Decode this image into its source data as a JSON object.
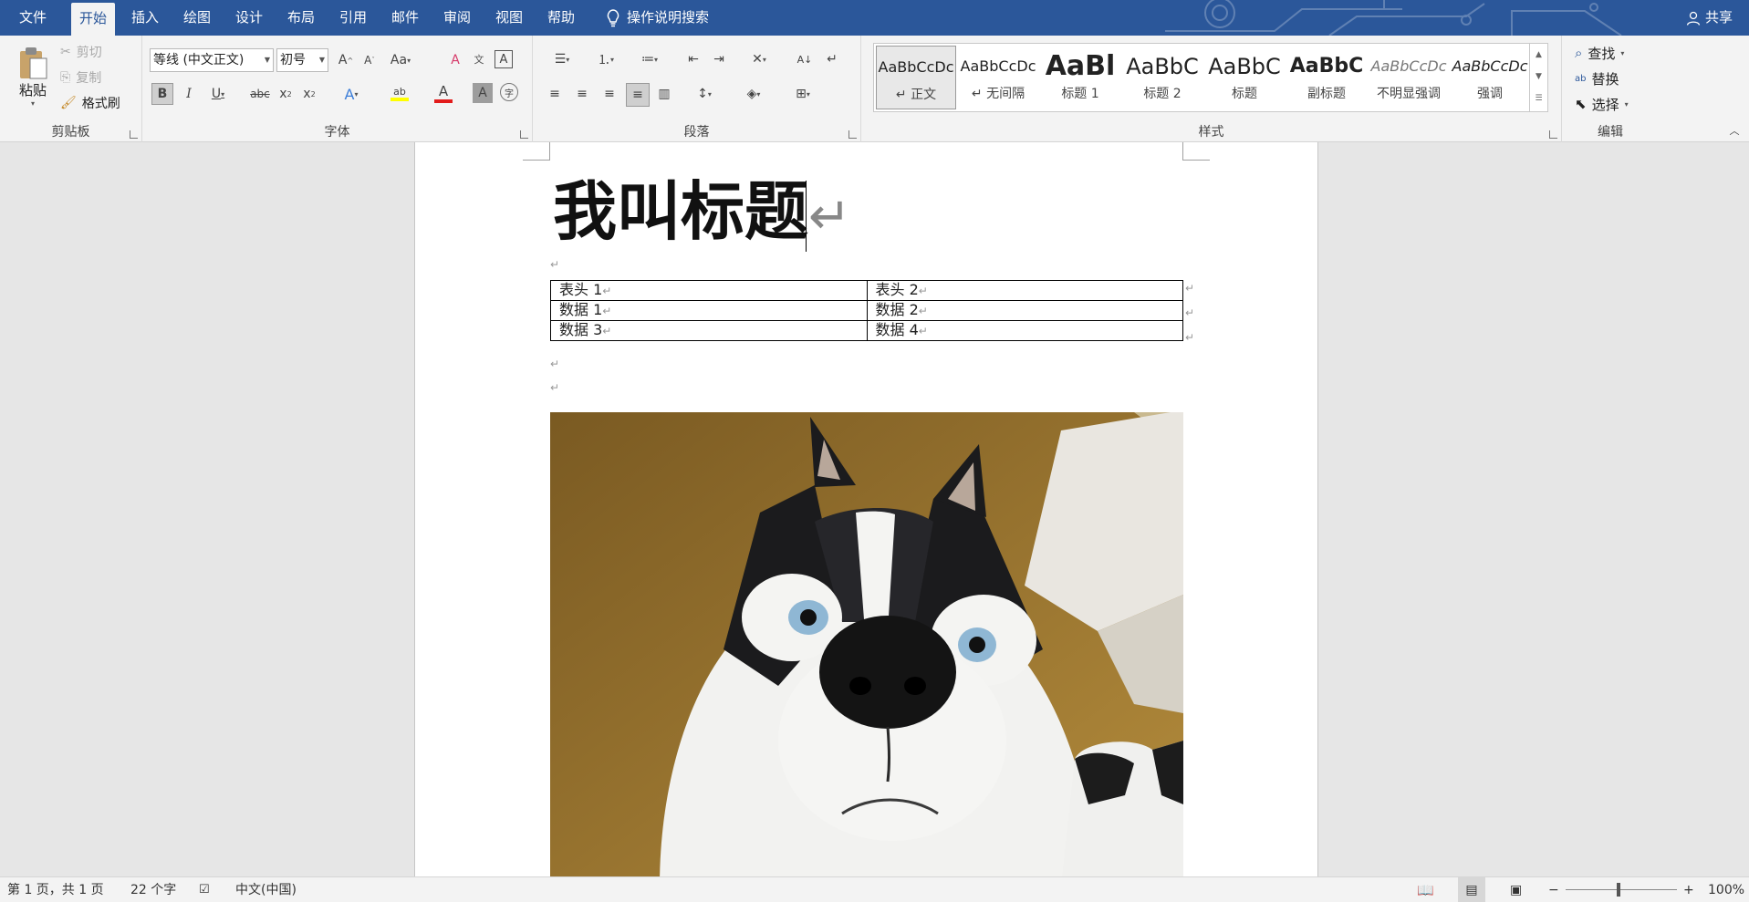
{
  "menu": {
    "tabs": [
      "文件",
      "开始",
      "插入",
      "绘图",
      "设计",
      "布局",
      "引用",
      "邮件",
      "审阅",
      "视图",
      "帮助"
    ],
    "active_tab": "开始",
    "tell_me": "操作说明搜索",
    "share": "共享"
  },
  "ribbon": {
    "clipboard": {
      "paste": "粘贴",
      "cut": "剪切",
      "copy": "复制",
      "format_painter": "格式刷",
      "label": "剪贴板"
    },
    "font": {
      "font_name": "等线 (中文正文)",
      "font_size": "初号",
      "label": "字体"
    },
    "paragraph": {
      "label": "段落"
    },
    "styles": {
      "label": "样式",
      "items": [
        {
          "sample": "AaBbCcDc",
          "name": "↵ 正文"
        },
        {
          "sample": "AaBbCcDc",
          "name": "↵ 无间隔"
        },
        {
          "sample": "AaBl",
          "name": "标题 1"
        },
        {
          "sample": "AaBbC",
          "name": "标题 2"
        },
        {
          "sample": "AaBbC",
          "name": "标题"
        },
        {
          "sample": "AaBbC",
          "name": "副标题"
        },
        {
          "sample": "AaBbCcDc",
          "name": "不明显强调"
        },
        {
          "sample": "AaBbCcDc",
          "name": "强调"
        }
      ]
    },
    "editing": {
      "find": "查找",
      "replace": "替换",
      "select": "选择",
      "label": "编辑"
    }
  },
  "document": {
    "title": "我叫标题",
    "para_mark": "↵",
    "table": {
      "rows": [
        [
          "表头 1",
          "表头 2"
        ],
        [
          "数据 1",
          "数据 2"
        ],
        [
          "数据 3",
          "数据 4"
        ]
      ]
    }
  },
  "status": {
    "page": "第 1 页，共 1 页",
    "word_count": "22 个字",
    "language": "中文(中国)",
    "zoom": "100%"
  },
  "colors": {
    "accent": "#2b579a",
    "ribbon_bg": "#f3f3f3",
    "canvas_bg": "#e6e6e6"
  }
}
